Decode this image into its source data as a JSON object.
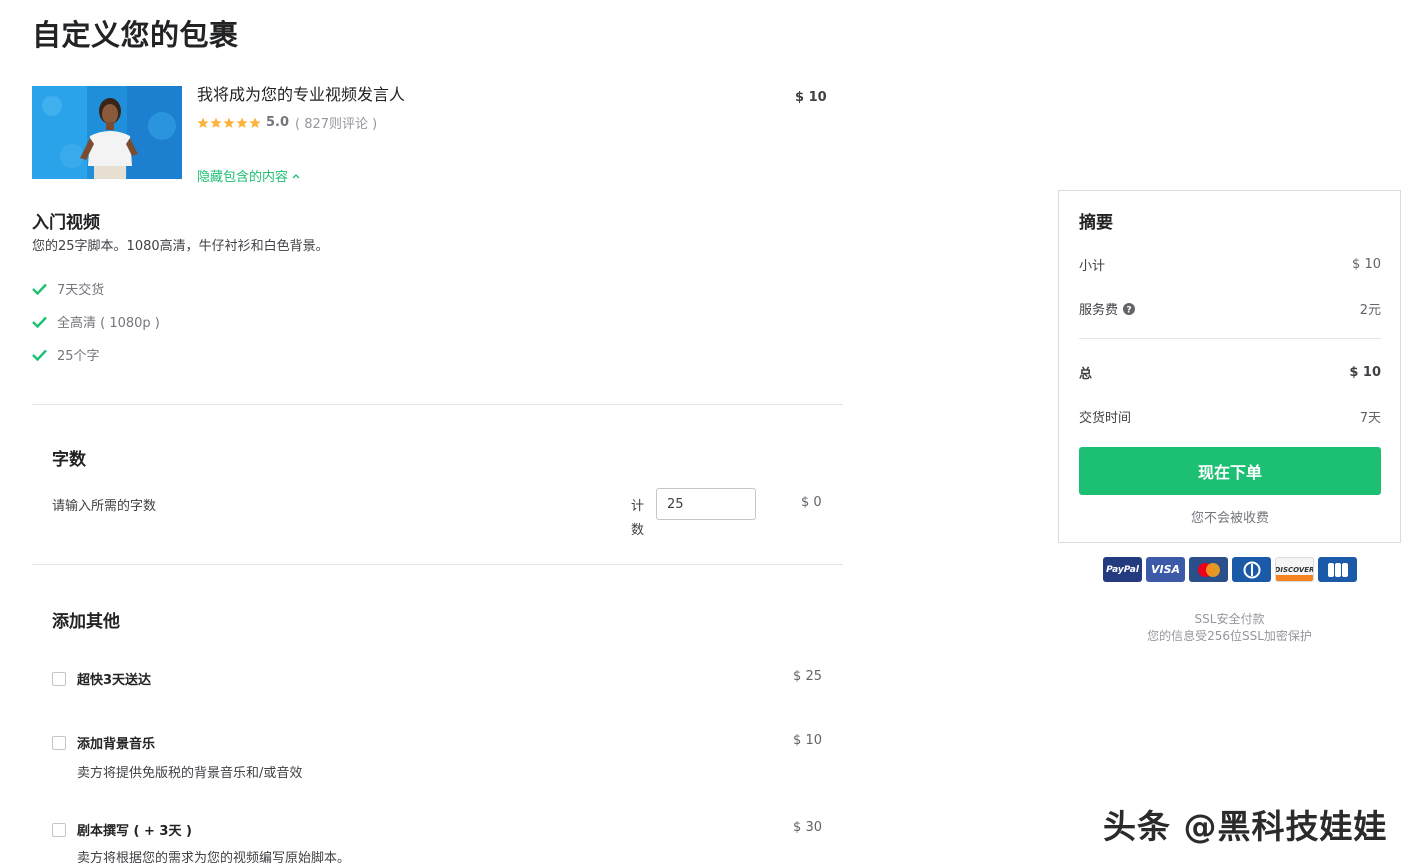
{
  "page": {
    "title": "自定义您的包裹"
  },
  "gig": {
    "title": "我将成为您的专业视频发言人",
    "rating": "5.0",
    "reviews": "( 827则评论 )",
    "price": "$ 10",
    "toggle_label": "隐藏包含的内容"
  },
  "package": {
    "name": "入门视频",
    "description": "您的25字脚本。1080高清，牛仔衬衫和白色背景。",
    "features": [
      "7天交货",
      "全高清 ( 1080p )",
      "25个字"
    ]
  },
  "word_count": {
    "section_title": "字数",
    "label": "请输入所需的字数",
    "count_word": "计数",
    "value": "25",
    "price": "$ 0"
  },
  "extras": {
    "section_title": "添加其他",
    "items": [
      {
        "title": "超快3天送达",
        "price": "$ 25",
        "description": ""
      },
      {
        "title": "添加背景音乐",
        "price": "$ 10",
        "description": "卖方将提供免版税的背景音乐和/或音效"
      },
      {
        "title": "剧本撰写 ( + 3天 )",
        "price": "$ 30",
        "description": "卖方将根据您的需求为您的视频编写原始脚本。"
      }
    ]
  },
  "summary": {
    "title": "摘要",
    "subtotal_label": "小计",
    "subtotal": "$ 10",
    "service_fee_label": "服务费",
    "service_fee": "2元",
    "total_label": "总",
    "total": "$ 10",
    "delivery_label": "交货时间",
    "delivery": "7天",
    "order_button": "现在下单",
    "no_charge": "您不会被收费"
  },
  "payment": {
    "methods": [
      "PayPal",
      "VISA",
      "MasterCard",
      "Diners",
      "DISCOVER",
      "JCB"
    ],
    "ssl_title": "SSL安全付款",
    "ssl_desc": "您的信息受256位SSL加密保护"
  },
  "watermark": "头条 @黑科技娃娃",
  "colors": {
    "accent": "#1dbf73",
    "star": "#ffb33e",
    "text": "#404145"
  }
}
